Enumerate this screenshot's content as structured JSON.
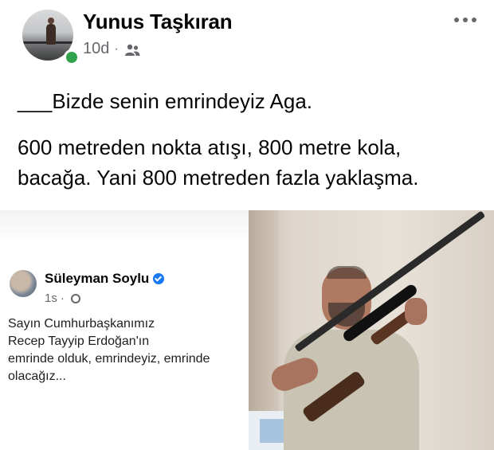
{
  "post": {
    "author_name": "Yunus Taşkıran",
    "time": "10d",
    "separator": "·",
    "audience_icon": "friends-icon",
    "more_icon": "more-dots-icon",
    "text_line1": "___Bizde senin emrindeyiz Aga.",
    "text_line2": "600 metreden nokta atışı, 800 metre kola,",
    "text_line3": "bacağa. Yani 800 metreden fazla yaklaşma."
  },
  "embedded": {
    "author_name": "Süleyman Soylu",
    "time": "1s",
    "separator": "·",
    "text_lines": [
      "Sayın Cumhurbaşkanımız",
      "Recep Tayyip Erdoğan'ın",
      "emrinde olduk, emrindeyiz, emrinde",
      "olacağız..."
    ]
  },
  "colors": {
    "online": "#31a24c",
    "verified": "#1877f2",
    "meta_text": "#65676b"
  }
}
